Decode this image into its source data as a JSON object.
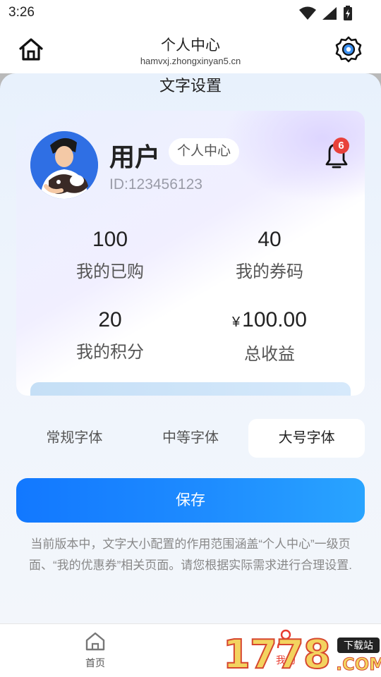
{
  "status_bar": {
    "time": "3:26"
  },
  "header": {
    "title": "个人中心",
    "url": "hamvxj.zhongxinyan5.cn"
  },
  "sheet": {
    "title": "文字设置",
    "preview": {
      "user_name": "用户",
      "user_tag": "个人中心",
      "user_id": "ID:123456123",
      "notification_count": "6",
      "stats": [
        {
          "value": "100",
          "label": "我的已购"
        },
        {
          "value": "40",
          "label": "我的券码"
        },
        {
          "value": "20",
          "label": "我的积分"
        },
        {
          "currency": "¥",
          "value": "100.00",
          "label": "总收益"
        }
      ]
    },
    "font_options": [
      "常规字体",
      "中等字体",
      "大号字体"
    ],
    "selected_font": "大号字体",
    "save_label": "保存",
    "notice": "当前版本中，文字大小配置的作用范围涵盖“个人中心”一级页面、“我的优惠券”相关页面。请您根据实际需求进行合理设置."
  },
  "bottom_nav": {
    "home_label": "首页",
    "mine_label": "我的"
  },
  "watermark": {
    "number": "1778",
    "tag": "下载站",
    "suffix": ".COM"
  },
  "colors": {
    "accent": "#1e8cff",
    "badge": "#e8413b",
    "nav_active": "#e83a2f"
  }
}
